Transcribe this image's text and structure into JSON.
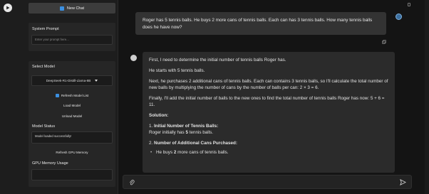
{
  "sidebar": {
    "new_chat_label": "New Chat",
    "system_prompt": {
      "label": "System Prompt",
      "placeholder": "Enter your prompt here..."
    },
    "select_model": {
      "label": "Select Model",
      "selected": "DeepSeek-R1-Distill-Llama-8B",
      "refresh_label": "Refresh Model List",
      "load_label": "Load Model",
      "unload_label": "Unload Model"
    },
    "model_status": {
      "label": "Model Status",
      "value": "Model loaded successfully!"
    },
    "refresh_gpu_label": "Refresh GPU Memory",
    "gpu_memory": {
      "label": "GPU Memory Usage"
    }
  },
  "chat": {
    "user_message": "Roger has 5 tennis balls. He buys 2 more cans of tennis balls. Each can has 3 tennis balls. How many tennis balls does he have now?",
    "assistant": {
      "p1": "First, I need to determine the initial number of tennis balls Roger has.",
      "p2": "He starts with 5 tennis balls.",
      "p3": "Next, he purchases 2 additional cans of tennis balls. Each can contains 3 tennis balls, so I'll calculate the total number of new balls by multiplying the number of cans by the number of balls per can: 2 × 3 = 6.",
      "p4": "Finally, I'll add the initial number of balls to the new ones to find the total number of tennis balls Roger has now: 5 + 6 = 11.",
      "solution_heading": "Solution:",
      "step1_num": "1.",
      "step1_title": "Initial Number of Tennis Balls:",
      "step1_pre": "Roger initially has ",
      "step1_bold": "5",
      "step1_post": " tennis balls.",
      "step2_num": "2.",
      "step2_title": "Number of Additional Cans Purchased:",
      "bullet_pre": "He buys ",
      "bullet_bold": "2",
      "bullet_post": " more cans of tennis balls."
    }
  },
  "colors": {
    "background": "#141414",
    "sidebar": "#1d1d1d",
    "panel": "#262626",
    "accent": "#3b8fe0"
  },
  "icons": [
    "play-icon",
    "chat-icon",
    "refresh-icon",
    "caret-down-icon",
    "avatar-user",
    "avatar-bot",
    "copy-icon",
    "paperclip-icon",
    "send-icon",
    "scroll-top-icon"
  ]
}
